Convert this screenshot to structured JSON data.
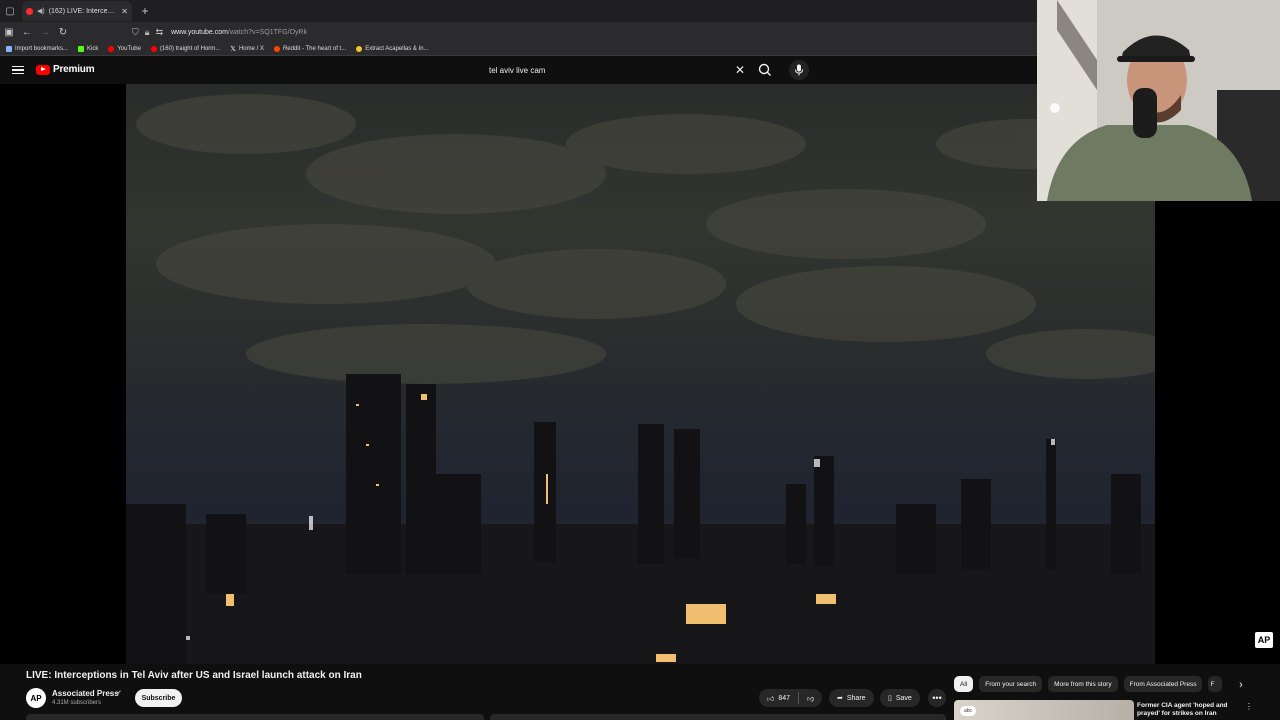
{
  "browser": {
    "tab_title": "(162) LIVE: Interceptions in",
    "url_host": "www.youtube.com",
    "url_path": "/watch?v=SQ1TFG/OyRk"
  },
  "bookmarks": [
    {
      "label": "Import bookmarks...",
      "color": "#8ab4f8"
    },
    {
      "label": "Kick",
      "color": "#53fc18"
    },
    {
      "label": "YouTube",
      "color": "#ff0000"
    },
    {
      "label": "(160) traight of Horm...",
      "color": "#ff0000"
    },
    {
      "label": "Home / X",
      "color": "#ffffff"
    },
    {
      "label": "Reddit - The heart of t...",
      "color": "#ff4500"
    },
    {
      "label": "Extract Acapellas & In...",
      "color": "#f4c430"
    }
  ],
  "header": {
    "logo_text": "Premium",
    "search_value": "tel aviv live cam"
  },
  "video": {
    "title": "LIVE: Interceptions in Tel Aviv after US and Israel launch attack on Iran",
    "channel_avatar": "AP",
    "channel_name": "Associated Press",
    "subscribers": "4.31M subscribers",
    "subscribe_label": "Subscribe",
    "watermark": "AP"
  },
  "actions": {
    "likes": "847",
    "share_label": "Share",
    "save_label": "Save"
  },
  "chips": [
    "All",
    "From your search",
    "More from this story",
    "From Associated Press",
    "F"
  ],
  "recommendation": {
    "thumb_logo": "abc",
    "title": "Former CIA agent 'hoped and prayed' for strikes on Iran"
  },
  "colors": {
    "accent": "#ff0000",
    "background": "#0f0f0f"
  }
}
